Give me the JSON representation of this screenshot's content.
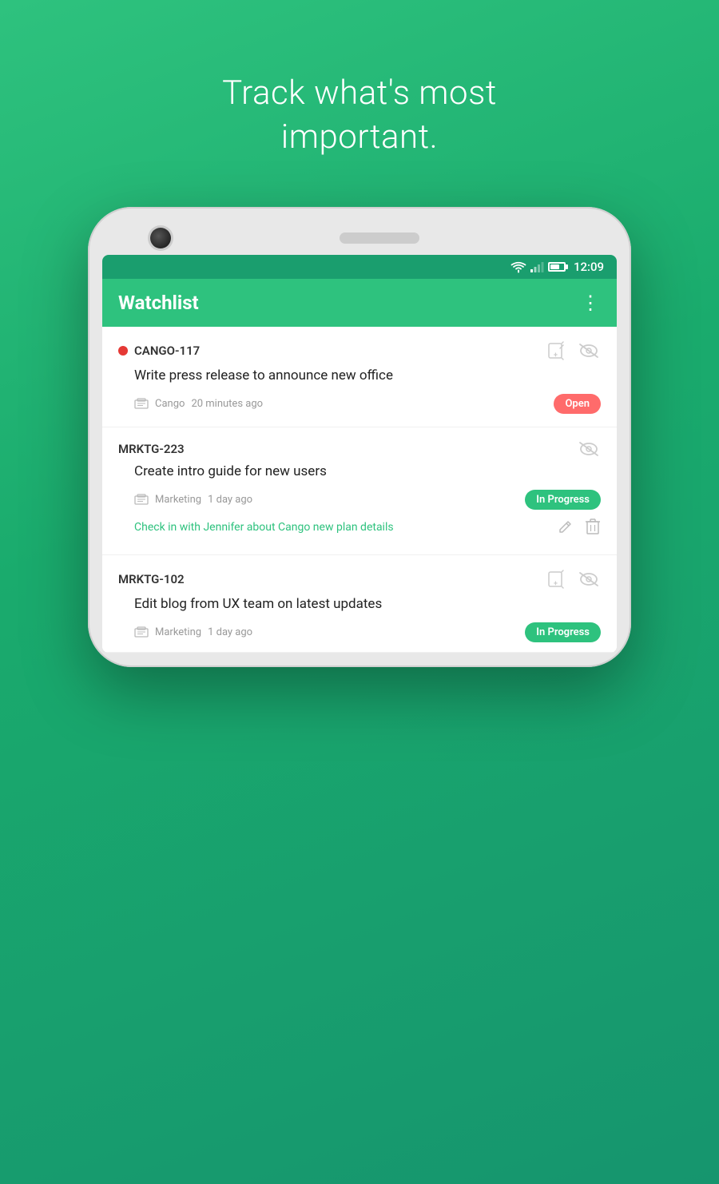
{
  "tagline": {
    "line1": "Track what's most",
    "line2": "important."
  },
  "status_bar": {
    "time": "12:09"
  },
  "toolbar": {
    "title": "Watchlist",
    "more_label": "⋮"
  },
  "items": [
    {
      "id": "CANGO-117",
      "has_red_dot": true,
      "title": "Write press release to announce new office",
      "project": "Cango",
      "time_ago": "20 minutes ago",
      "status": "Open",
      "status_type": "open",
      "has_add_note": true,
      "has_eye_slash": true,
      "sub_item": null
    },
    {
      "id": "MRKTG-223",
      "has_red_dot": false,
      "title": "Create intro guide for new users",
      "project": "Marketing",
      "time_ago": "1 day ago",
      "status": "In Progress",
      "status_type": "in_progress",
      "has_add_note": false,
      "has_eye_slash": true,
      "sub_item": {
        "text": "Check in with Jennifer about Cango new plan details",
        "has_edit": true,
        "has_delete": true
      }
    },
    {
      "id": "MRKTG-102",
      "has_red_dot": false,
      "title": "Edit blog from UX team on latest updates",
      "project": "Marketing",
      "time_ago": "1 day ago",
      "status": "In Progress",
      "status_type": "in_progress",
      "has_add_note": true,
      "has_eye_slash": true,
      "sub_item": null
    }
  ],
  "icons": {
    "add_note": "add-note-icon",
    "eye_slash": "eye-slash-icon",
    "pencil": "pencil-icon",
    "trash": "trash-icon",
    "project": "project-icon"
  }
}
